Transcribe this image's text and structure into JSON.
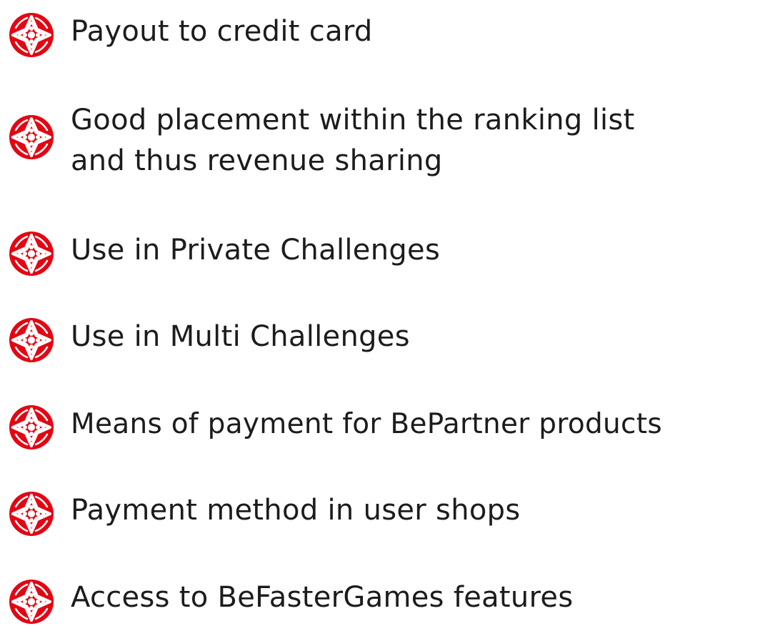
{
  "brand_color": "#e30613",
  "icon": "befaster-logo-icon",
  "items": [
    {
      "label": "Payout to credit card"
    },
    {
      "lines": [
        "Good placement within the ranking list",
        "and thus revenue sharing"
      ]
    },
    {
      "label": "Use in Private Challenges"
    },
    {
      "label": "Use in Multi Challenges"
    },
    {
      "label": "Means of payment for BePartner products"
    },
    {
      "label": "Payment method in user shops"
    },
    {
      "label": "Access to BeFasterGames features"
    }
  ]
}
